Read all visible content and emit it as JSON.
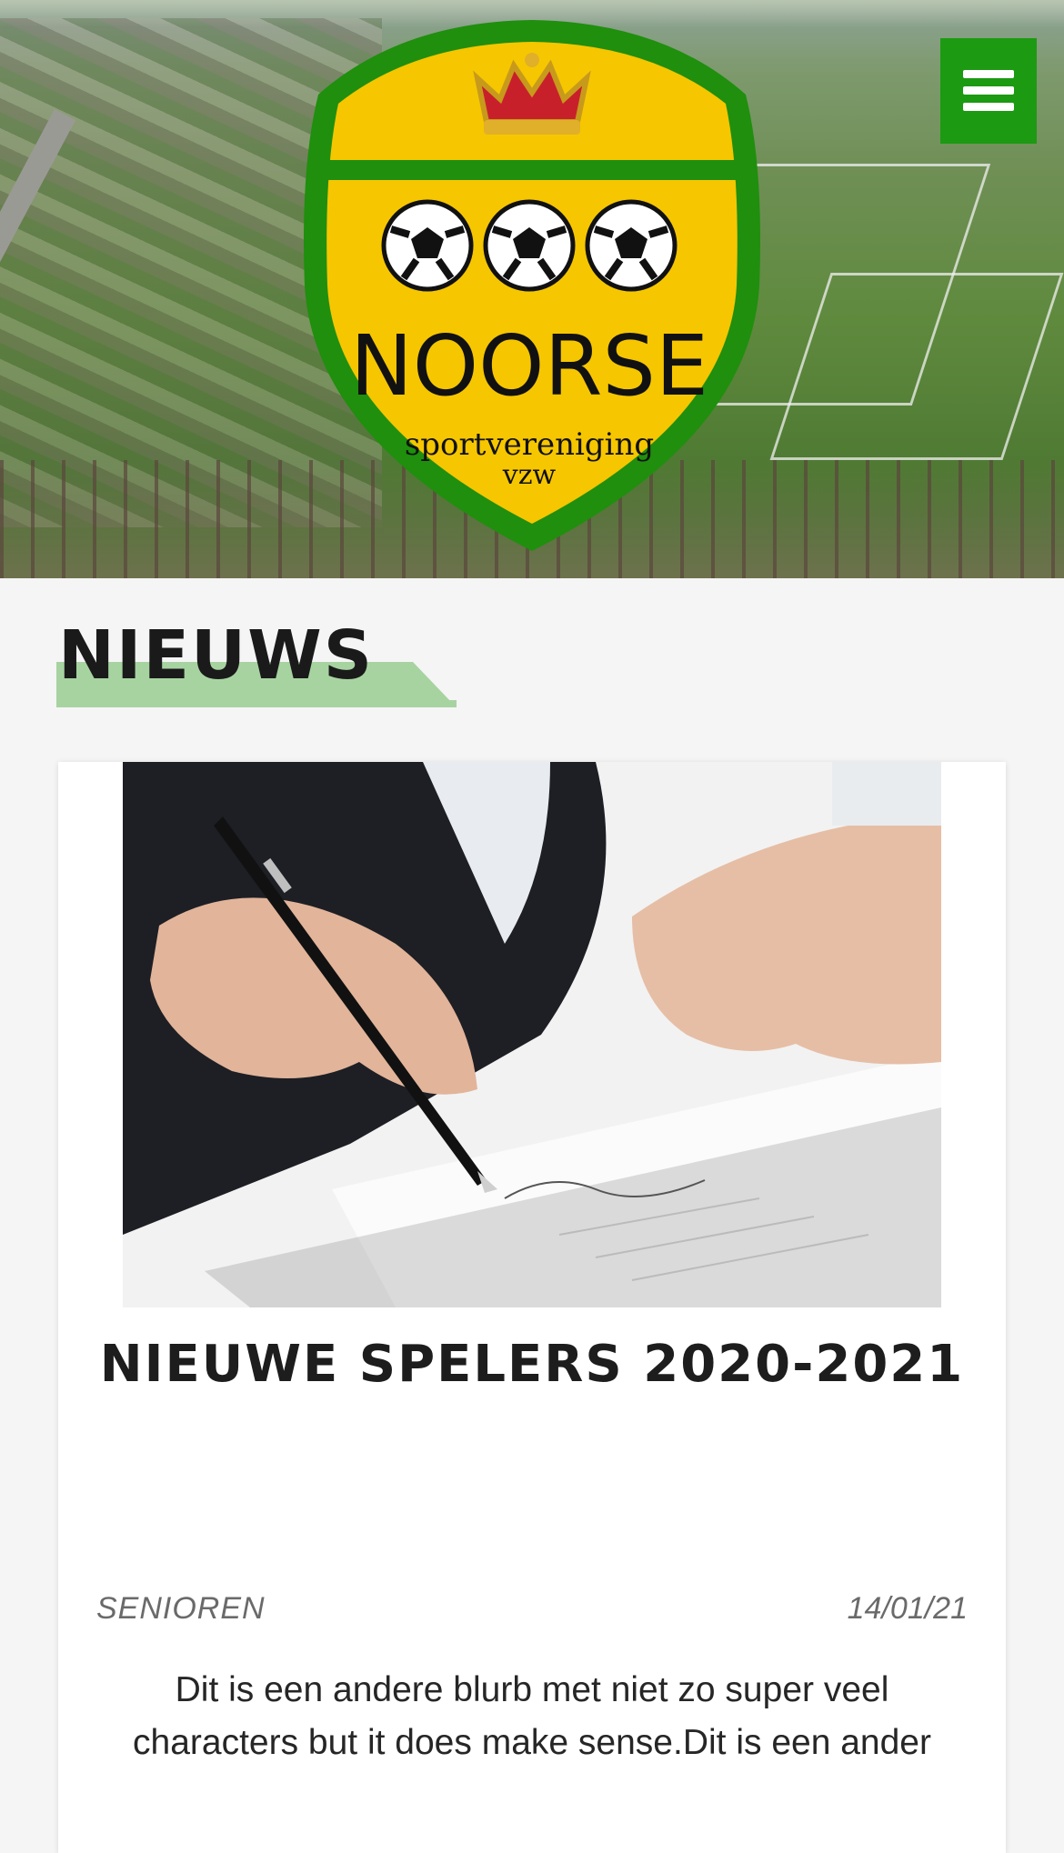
{
  "header": {
    "logo": {
      "name": "NOORSE",
      "tagline_1": "sportvereniging",
      "tagline_2": "vzw"
    },
    "menu_icon": "hamburger-menu-icon",
    "accent_color": "#1c9a12",
    "crest_colors": {
      "shield": "#f6c600",
      "border": "#1f8f0d",
      "crown": "#c8202a"
    }
  },
  "section": {
    "title": "NIEUWS",
    "title_highlight_color": "#a7d3a1"
  },
  "news": [
    {
      "title": "NIEUWE SPELERS 2020-2021",
      "category": "SENIOREN",
      "date": "14/01/21",
      "excerpt": "Dit is een andere blurb met niet zo super veel characters but it does make sense.Dit is een ander"
    }
  ]
}
